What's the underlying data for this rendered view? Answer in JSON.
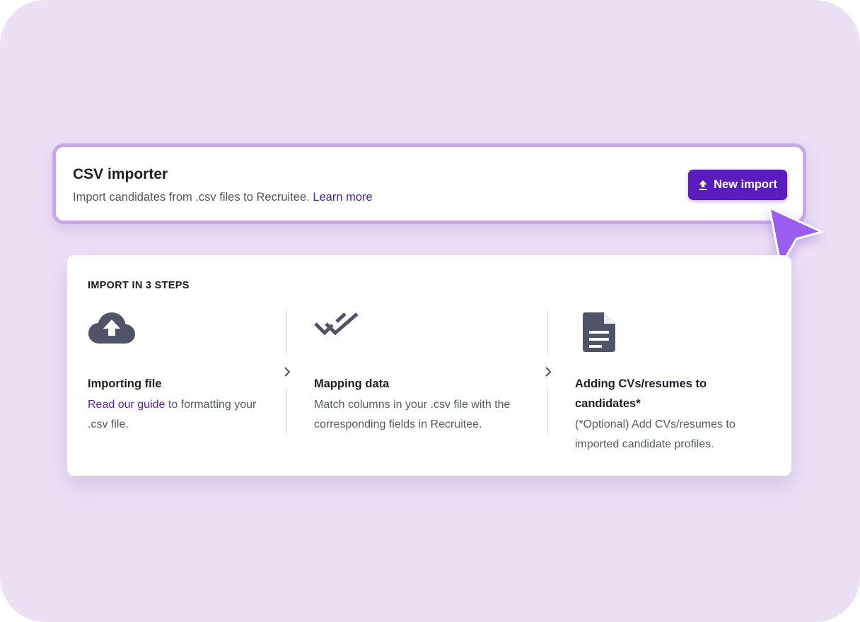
{
  "importer": {
    "title": "CSV importer",
    "subtitle": "Import candidates from .csv files to Recruitee.",
    "learn_more": "Learn more",
    "button": {
      "icon": "upload-icon",
      "label": "New import"
    }
  },
  "steps": {
    "heading": "IMPORT IN 3 STEPS",
    "items": [
      {
        "icon": "cloud-upload-icon",
        "title": "Importing file",
        "link": "Read our guide",
        "desc": " to formatting your .csv file."
      },
      {
        "icon": "double-check-icon",
        "title": "Mapping data",
        "desc": "Match columns in your .csv file with the corresponding fields in Recruitee."
      },
      {
        "icon": "document-icon",
        "title": "Adding CVs/resumes to candidates*",
        "desc": "(*Optional) Add CVs/resumes to imported candidate profiles."
      }
    ]
  },
  "colors": {
    "background": "#ece0f5",
    "accent": "#5a1cbf",
    "link": "#4d1fad",
    "cursor": "#9b5cf0",
    "icon": "#4f5468",
    "card_border": "#c7a9ea"
  }
}
